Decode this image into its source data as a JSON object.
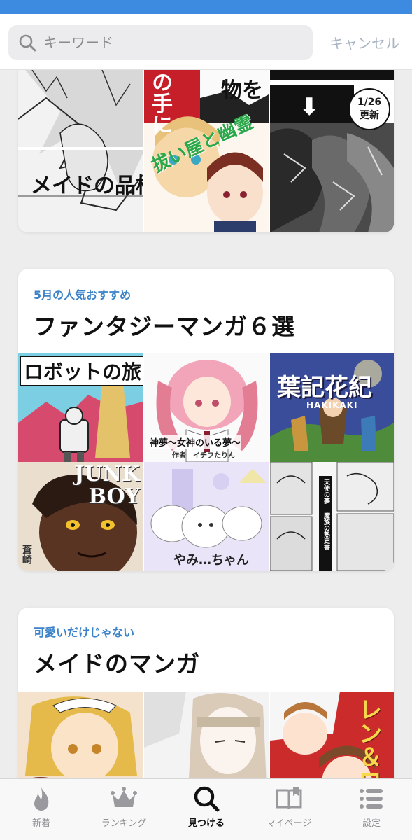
{
  "search": {
    "placeholder": "キーワード",
    "cancel_label": "キャンセル"
  },
  "card1": {
    "tiles": [
      {
        "caption": "メイドの品格"
      },
      {
        "caption_top": "の手に",
        "caption_side": "物を",
        "caption_logo": "拔い屋と幽霊"
      },
      {
        "badge_date": "1/26",
        "badge_label": "更新"
      }
    ]
  },
  "card2": {
    "kicker": "5月の人気おすすめ",
    "title": "ファンタジーマンガ６選",
    "tiles": [
      {
        "caption": "ロボットの旅"
      },
      {
        "caption": "神夢～女神のいる夢～",
        "subcaption": "作者　イチフたりん"
      },
      {
        "caption": "葉記花紀",
        "subcaption": "HAKIKAKI"
      },
      {
        "caption": "JUNK BOY",
        "subcaption": "蒼崎"
      },
      {
        "caption": "やみ…ちゃん"
      },
      {
        "caption": "天使の夢",
        "subcaption": "魔族の熟史書"
      }
    ]
  },
  "card3": {
    "kicker": "可愛いだけじゃない",
    "title": "メイドのマンガ",
    "tiles": [
      {
        "caption": ""
      },
      {
        "caption": ""
      },
      {
        "caption": "レン＆ロ"
      }
    ]
  },
  "tabs": [
    {
      "label": "新着",
      "icon": "flame-icon",
      "active": false
    },
    {
      "label": "ランキング",
      "icon": "crown-icon",
      "active": false
    },
    {
      "label": "見つける",
      "icon": "search-icon",
      "active": true
    },
    {
      "label": "マイページ",
      "icon": "book-icon",
      "active": false
    },
    {
      "label": "設定",
      "icon": "list-icon",
      "active": false
    }
  ],
  "colors": {
    "status_bar": "#3c8be0",
    "accent": "#3b82c8",
    "cancel": "#a8b4c4"
  }
}
